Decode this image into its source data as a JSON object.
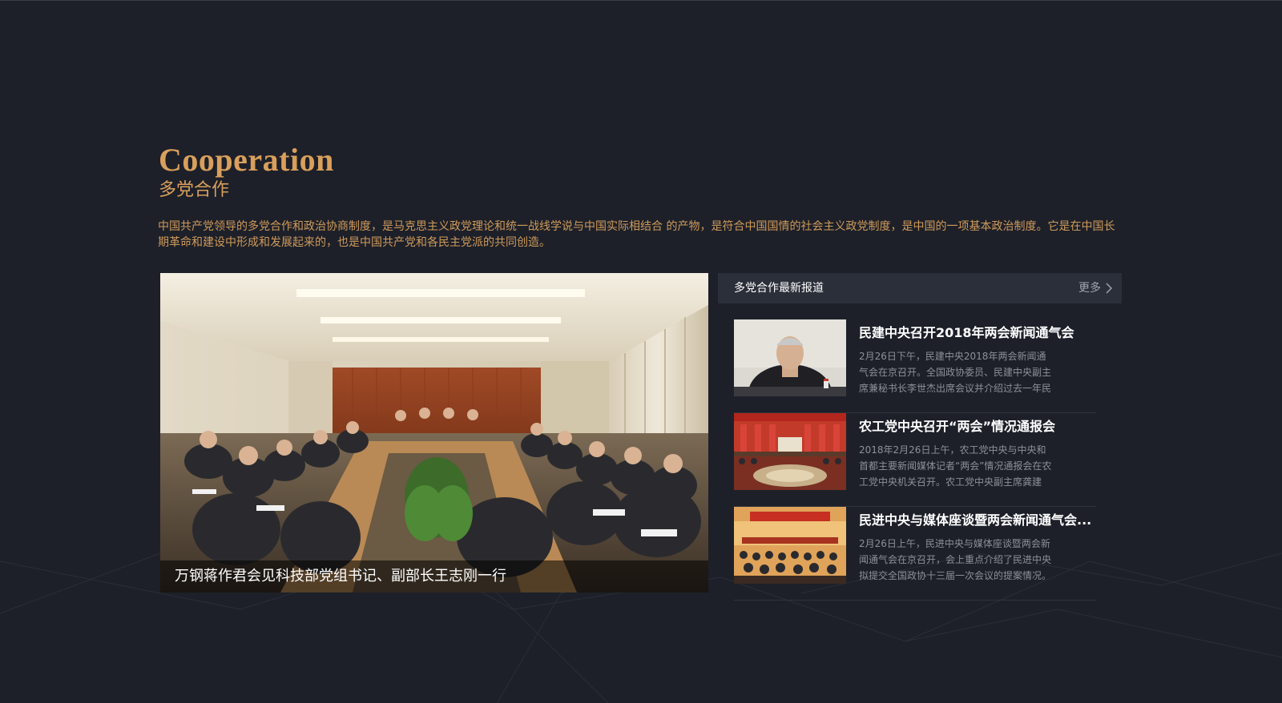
{
  "section": {
    "title_en": "Cooperation",
    "title_cn": "多党合作",
    "intro": "中国共产党领导的多党合作和政治协商制度，是马克思主义政党理论和统一战线学说与中国实际相结合 的产物，是符合中国国情的社会主义政党制度，是中国的一项基本政治制度。它是在中国长期革命和建设中形成和发展起来的，也是中国共产党和各民主党派的共同创造。"
  },
  "featured": {
    "caption": "万钢蒋作君会见科技部党组书记、副部长王志刚一行"
  },
  "news": {
    "header_title": "多党合作最新报道",
    "more_label": "更多",
    "items": [
      {
        "title": "民建中央召开2018年两会新闻通气会",
        "desc": "2月26日下午，民建中央2018年两会新闻通气会在京召开。全国政协委员、民建中央副主席兼秘书长李世杰出席会议并介绍过去一年民"
      },
      {
        "title": "农工党中央召开“两会”情况通报会",
        "desc": "2018年2月26日上午，农工党中央与中央和首都主要新闻媒体记者“两会”情况通报会在农工党中央机关召开。农工党中央副主席龚建"
      },
      {
        "title": "民进中央与媒体座谈暨两会新闻通气会...",
        "desc": "2月26日上午，民进中央与媒体座谈暨两会新闻通气会在京召开，会上重点介绍了民进中央拟提交全国政协十三届一次会议的提案情况。"
      }
    ]
  },
  "colors": {
    "background": "#1d2029",
    "accent_gold": "#d99f5c",
    "news_header_bg": "#2b2f39"
  }
}
